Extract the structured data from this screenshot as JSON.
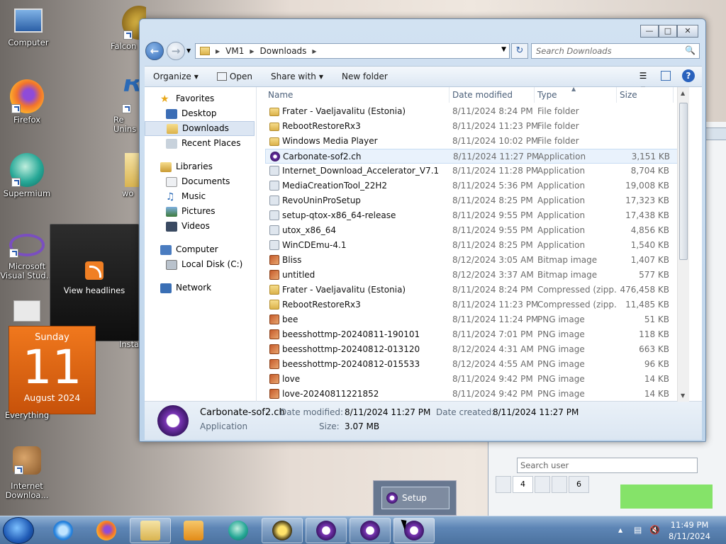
{
  "desktop": {
    "icons": [
      {
        "label": "Computer",
        "icon": "computer-icon"
      },
      {
        "label": "Falcon",
        "icon": "falcon-icon"
      },
      {
        "label": "Firefox",
        "icon": "firefox-icon"
      },
      {
        "label": "Re\nUnins",
        "icon": "revo-icon"
      },
      {
        "label": "Supermium",
        "icon": "supermium-icon"
      },
      {
        "label": "wo",
        "icon": "folder-icon"
      },
      {
        "label": "Microsoft\nVisual Stud...",
        "icon": "visual-studio-icon"
      },
      {
        "label": "Internet\nDownloa...",
        "icon": "internet-download-icon"
      },
      {
        "label": "Everything",
        "icon": "everything-icon"
      },
      {
        "label": "Insta",
        "icon": "installer-icon"
      }
    ],
    "rss_gadget": {
      "label": "View headlines"
    },
    "calendar_gadget": {
      "day": "Sunday",
      "date": "11",
      "month_year": "August 2024"
    }
  },
  "explorer": {
    "breadcrumb": [
      "VM1",
      "Downloads"
    ],
    "search_placeholder": "Search Downloads",
    "toolbar": {
      "organize": "Organize",
      "open": "Open",
      "share_with": "Share with",
      "new_folder": "New folder"
    },
    "nav": {
      "favorites": "Favorites",
      "desktop": "Desktop",
      "downloads": "Downloads",
      "recent_places": "Recent Places",
      "libraries": "Libraries",
      "documents": "Documents",
      "music": "Music",
      "pictures": "Pictures",
      "videos": "Videos",
      "computer": "Computer",
      "local_disk": "Local Disk (C:)",
      "network": "Network"
    },
    "columns": {
      "name": "Name",
      "date": "Date modified",
      "type": "Type",
      "size": "Size"
    },
    "files": [
      {
        "name": "Frater - Vaeljavalitu (Estonia)",
        "date": "8/11/2024 8:24 PM",
        "type": "File folder",
        "size": "",
        "kind": "folder"
      },
      {
        "name": "RebootRestoreRx3",
        "date": "8/11/2024 11:23 PM",
        "type": "File folder",
        "size": "",
        "kind": "folder"
      },
      {
        "name": "Windows Media Player",
        "date": "8/11/2024 10:02 PM",
        "type": "File folder",
        "size": "",
        "kind": "folder"
      },
      {
        "name": "Carbonate-sof2.ch",
        "date": "8/11/2024 11:27 PM",
        "type": "Application",
        "size": "3,151 KB",
        "kind": "app"
      },
      {
        "name": "Internet_Download_Accelerator_V7.1",
        "date": "8/11/2024 11:28 PM",
        "type": "Application",
        "size": "8,704 KB",
        "kind": "gen"
      },
      {
        "name": "MediaCreationTool_22H2",
        "date": "8/11/2024 5:36 PM",
        "type": "Application",
        "size": "19,008 KB",
        "kind": "gen"
      },
      {
        "name": "RevoUninProSetup",
        "date": "8/11/2024 8:25 PM",
        "type": "Application",
        "size": "17,323 KB",
        "kind": "gen"
      },
      {
        "name": "setup-qtox-x86_64-release",
        "date": "8/11/2024 9:55 PM",
        "type": "Application",
        "size": "17,438 KB",
        "kind": "gen"
      },
      {
        "name": "utox_x86_64",
        "date": "8/11/2024 9:55 PM",
        "type": "Application",
        "size": "4,856 KB",
        "kind": "gen"
      },
      {
        "name": "WinCDEmu-4.1",
        "date": "8/11/2024 8:25 PM",
        "type": "Application",
        "size": "1,540 KB",
        "kind": "gen"
      },
      {
        "name": "Bliss",
        "date": "8/12/2024 3:05 AM",
        "type": "Bitmap image",
        "size": "1,407 KB",
        "kind": "img"
      },
      {
        "name": "untitled",
        "date": "8/12/2024 3:37 AM",
        "type": "Bitmap image",
        "size": "577 KB",
        "kind": "img"
      },
      {
        "name": "Frater - Vaeljavalitu (Estonia)",
        "date": "8/11/2024 8:24 PM",
        "type": "Compressed (zipp...",
        "size": "476,458 KB",
        "kind": "zip"
      },
      {
        "name": "RebootRestoreRx3",
        "date": "8/11/2024 11:23 PM",
        "type": "Compressed (zipp...",
        "size": "11,485 KB",
        "kind": "zip"
      },
      {
        "name": "bee",
        "date": "8/11/2024 11:24 PM",
        "type": "PNG image",
        "size": "51 KB",
        "kind": "img"
      },
      {
        "name": "beesshottmp-20240811-190101",
        "date": "8/11/2024 7:01 PM",
        "type": "PNG image",
        "size": "118 KB",
        "kind": "img"
      },
      {
        "name": "beesshottmp-20240812-013120",
        "date": "8/12/2024 4:31 AM",
        "type": "PNG image",
        "size": "663 KB",
        "kind": "img"
      },
      {
        "name": "beesshottmp-20240812-015533",
        "date": "8/12/2024 4:55 AM",
        "type": "PNG image",
        "size": "96 KB",
        "kind": "img"
      },
      {
        "name": "love",
        "date": "8/11/2024 9:42 PM",
        "type": "PNG image",
        "size": "14 KB",
        "kind": "img"
      },
      {
        "name": "love-20240811221852",
        "date": "8/11/2024 9:42 PM",
        "type": "PNG image",
        "size": "14 KB",
        "kind": "img"
      }
    ],
    "details": {
      "name": "Carbonate-sof2.ch",
      "type": "Application",
      "date_modified_label": "Date modified:",
      "date_modified": "8/11/2024 11:27 PM",
      "date_created_label": "Date created:",
      "date_created": "8/11/2024 11:27 PM",
      "size_label": "Size:",
      "size": "3.07 MB"
    }
  },
  "background_app": {
    "search_placeholder": "Search user",
    "tabs": [
      "",
      "4",
      "",
      "",
      "6"
    ]
  },
  "setup_popup": {
    "label": "Setup"
  },
  "taskbar": {
    "time": "11:49 PM",
    "date": "8/11/2024"
  }
}
